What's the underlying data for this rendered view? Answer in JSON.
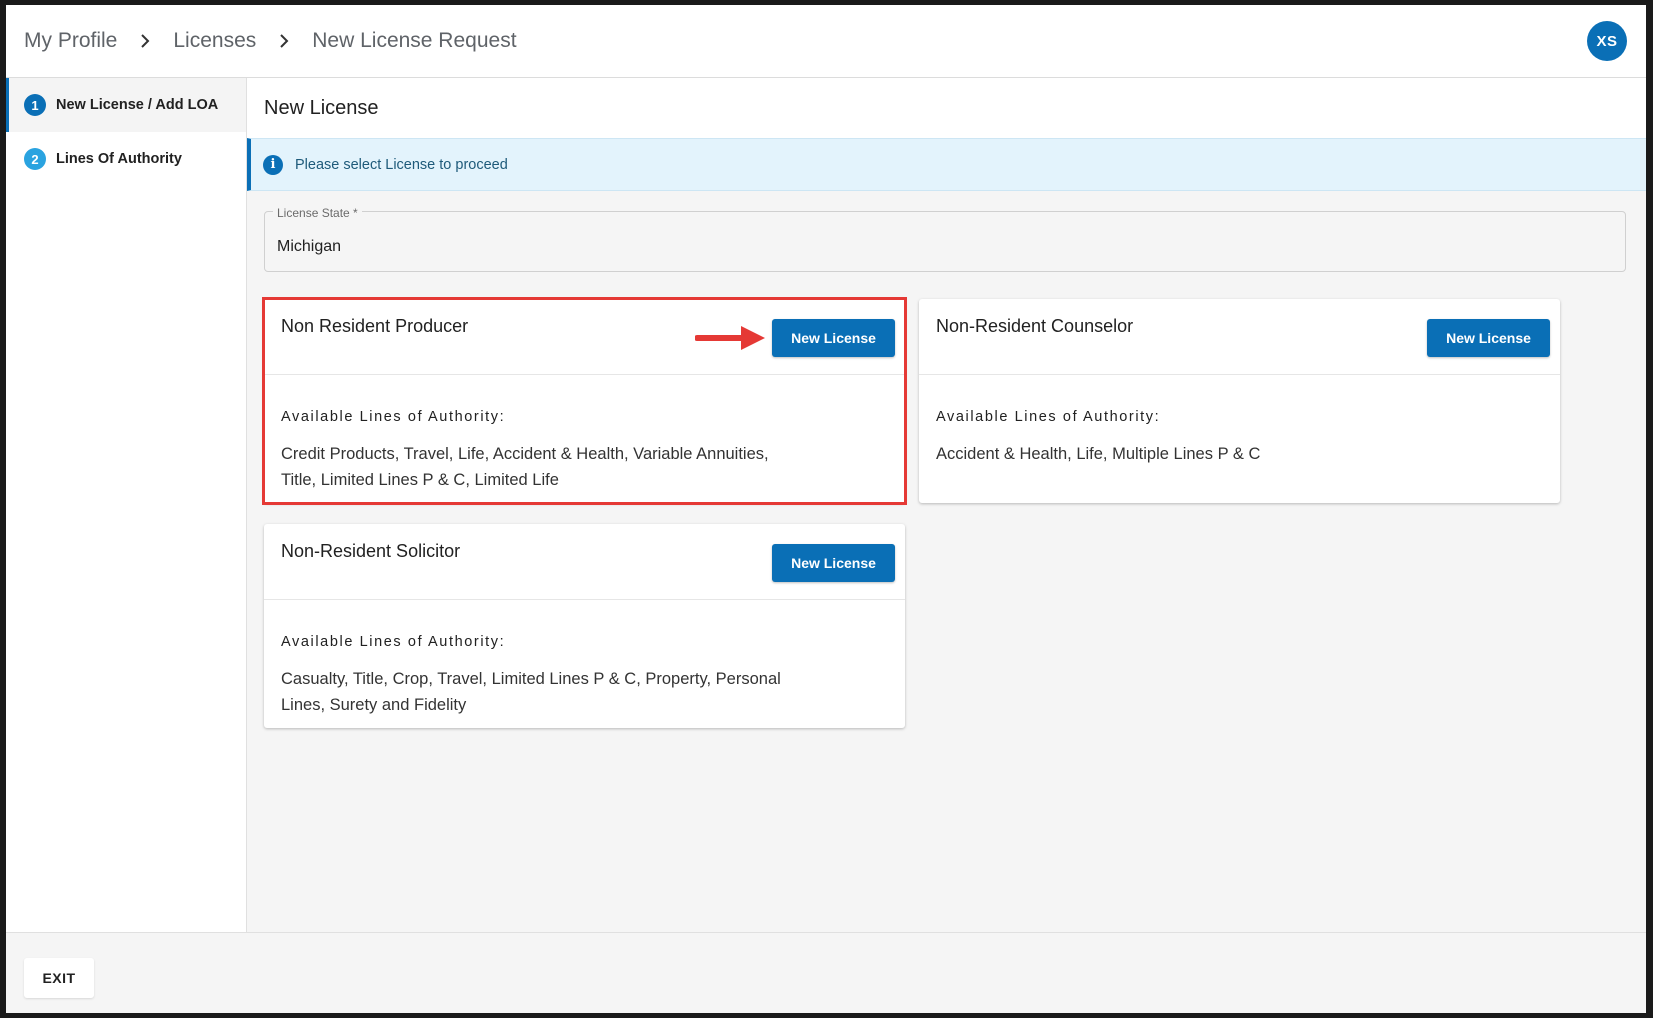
{
  "breadcrumb": [
    "My Profile",
    "Licenses",
    "New License Request"
  ],
  "user": {
    "initials": "XS"
  },
  "steps": [
    {
      "number": "1",
      "label": "New License / Add LOA"
    },
    {
      "number": "2",
      "label": "Lines Of Authority"
    }
  ],
  "page": {
    "title": "New License",
    "info_message": "Please select License to proceed"
  },
  "license_state": {
    "label": "License State *",
    "value": "Michigan"
  },
  "cards": [
    {
      "title": "Non Resident Producer",
      "button": "New License",
      "loa_heading": "Available Lines of Authority:",
      "loa": "Credit Products, Travel, Life, Accident & Health, Variable Annuities, Title, Limited Lines P & C, Limited Life"
    },
    {
      "title": "Non-Resident Counselor",
      "button": "New License",
      "loa_heading": "Available Lines of Authority:",
      "loa": "Accident & Health, Life, Multiple Lines P & C"
    },
    {
      "title": "Non-Resident Solicitor",
      "button": "New License",
      "loa_heading": "Available Lines of Authority:",
      "loa": "Casualty, Title, Crop, Travel, Limited Lines P & C, Property, Personal Lines, Surety and Fidelity"
    }
  ],
  "footer": {
    "exit_label": "EXIT"
  },
  "colors": {
    "primary": "#0a6fb6",
    "highlight": "#e53935"
  }
}
